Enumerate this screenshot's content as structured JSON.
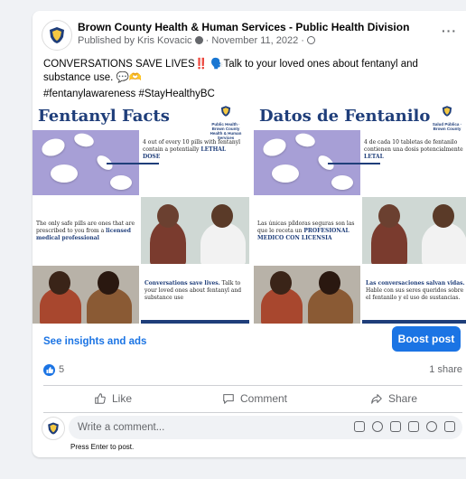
{
  "post": {
    "page_name": "Brown County Health & Human Services - Public Health Division",
    "published_by": "Published by Kris Kovacic",
    "date": "November 11, 2022",
    "more_label": "···",
    "line1": "CONVERSATIONS SAVE LIVES‼️ 🗣️Talk to your loved ones about fentanyl and substance use. 💬🫶",
    "line2": "#fentanylawareness #StayHealthyBC"
  },
  "image_en": {
    "title": "Fentanyl Facts",
    "logo_text": "Public Health · Brown County Health & Human Services",
    "fact1_pre": "4 out of every 10 pills with fentanyl contain a potentially",
    "fact1_bold": "LETHAL DOSE",
    "fact2_pre": "The only safe pills are ones that are prescribed to you from a",
    "fact2_bold": "licensed medical professional",
    "fact3_bold": "Conversations save lives.",
    "fact3_post": "Talk to your loved ones about fentanyl and substance use"
  },
  "image_es": {
    "title": "Datos de Fentanilo",
    "logo_text": "Salud Pública · Brown County",
    "fact1_pre": "4 de cada 10 tabletas de fentanilo contienen una dosis potencialmente",
    "fact1_bold": "LETAL",
    "fact2_pre": "Las únicas píldoras seguras son las que le receta un",
    "fact2_bold": "PROFESIONAL MEDICO CON LICENSIA",
    "fact3_bold": "Las conversaciones salvan vidas.",
    "fact3_post": "Hable con sus seres queridos sobre el fentanilo y el uso de sustancias."
  },
  "insights": {
    "label": "See insights and ads",
    "boost_label": "Boost post"
  },
  "reactions": {
    "count": "5",
    "shares": "1 share"
  },
  "actions": {
    "like": "Like",
    "comment": "Comment",
    "share": "Share"
  },
  "composer": {
    "placeholder": "Write a comment...",
    "hint": "Press Enter to post."
  },
  "colors": {
    "accent": "#1b74e4",
    "navy": "#1f3e7a",
    "lavender": "#a79fd6"
  }
}
